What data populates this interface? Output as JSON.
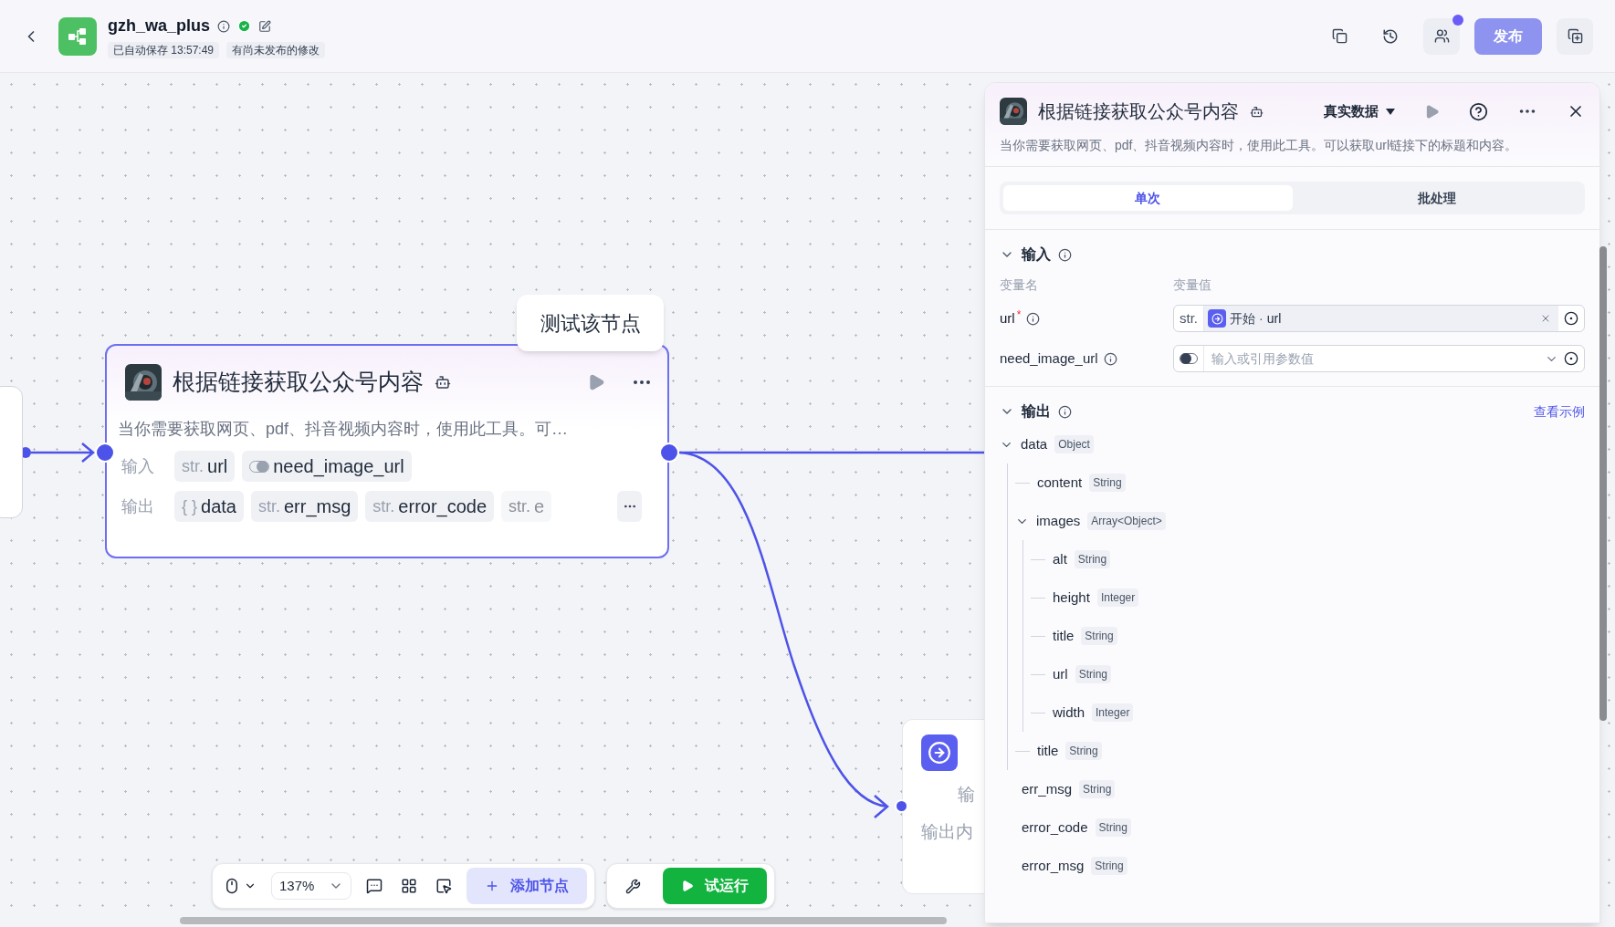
{
  "header": {
    "title": "gzh_wa_plus",
    "saved": "已自动保存 13:57:49",
    "unpublished": "有尚未发布的修改",
    "publish": {
      "label": "发布",
      "disabled": true
    }
  },
  "node": {
    "title": "根据链接获取公众号内容",
    "description": "当你需要获取网页、pdf、抖音视频内容时，使用此工具。可…",
    "input_label": "输入",
    "inputs": [
      {
        "kind": "string",
        "type_label": "str.",
        "name": "url"
      },
      {
        "kind": "boolean",
        "name": "need_image_url"
      }
    ],
    "output_label": "输出",
    "outputs": [
      {
        "type_label": "{ }",
        "name": "data",
        "faded": false
      },
      {
        "type_label": "str.",
        "name": "err_msg",
        "faded": false
      },
      {
        "type_label": "str.",
        "name": "error_code",
        "faded": false
      },
      {
        "type_label": "str.",
        "name": "e",
        "faded": true
      }
    ]
  },
  "tooltip": "测试该节点",
  "lower_node": {
    "rows": [
      "输",
      "输出内"
    ]
  },
  "toolbar": {
    "zoom": "137%",
    "add_node": "添加节点",
    "run": "试运行"
  },
  "panel": {
    "title": "根据链接获取公众号内容",
    "mode": "真实数据",
    "description": "当你需要获取网页、pdf、抖音视频内容时，使用此工具。可以获取url链接下的标题和内容。",
    "tabs": [
      {
        "label": "单次",
        "selected": true
      },
      {
        "label": "批处理",
        "selected": false
      }
    ],
    "input": {
      "title": "输入",
      "expanded": true,
      "col_name": "变量名",
      "col_value": "变量值",
      "params": [
        {
          "kind": "reference",
          "name": "url",
          "required": true,
          "type_label": "str.",
          "source": "开始",
          "separator": "·",
          "value": "url"
        },
        {
          "kind": "boolean",
          "name": "need_image_url",
          "required": false,
          "on": false,
          "placeholder": "输入或引用参数值"
        }
      ],
      "required_mark": "*"
    },
    "output": {
      "title": "输出",
      "expanded": true,
      "link": "查看示例",
      "fields": [
        {
          "name": "data",
          "type": "Object",
          "expanded": true,
          "children": [
            {
              "name": "content",
              "type": "String"
            },
            {
              "name": "images",
              "type": "Array<Object>",
              "expanded": true,
              "children": [
                {
                  "name": "alt",
                  "type": "String"
                },
                {
                  "name": "height",
                  "type": "Integer"
                },
                {
                  "name": "title",
                  "type": "String"
                },
                {
                  "name": "url",
                  "type": "String"
                },
                {
                  "name": "width",
                  "type": "Integer"
                }
              ]
            },
            {
              "name": "title",
              "type": "String"
            }
          ]
        },
        {
          "name": "err_msg",
          "type": "String"
        },
        {
          "name": "error_code",
          "type": "String"
        },
        {
          "name": "error_msg",
          "type": "String"
        }
      ]
    }
  }
}
